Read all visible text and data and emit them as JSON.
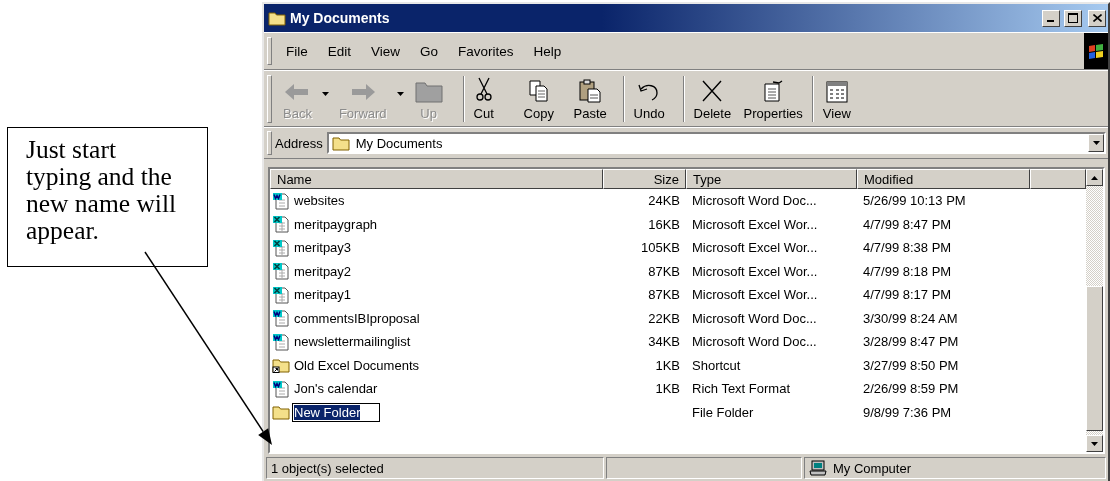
{
  "callout": {
    "text": "Just start typing and the new name will appear."
  },
  "window": {
    "title": "My Documents"
  },
  "menu": [
    "File",
    "Edit",
    "View",
    "Go",
    "Favorites",
    "Help"
  ],
  "toolbar": {
    "groups": [
      [
        {
          "label": "Back",
          "kind": "back",
          "disabled": true,
          "dropdown": true
        },
        {
          "label": "Forward",
          "kind": "forward",
          "disabled": true,
          "dropdown": true
        },
        {
          "label": "Up",
          "kind": "up",
          "disabled": true,
          "dropdown": false
        }
      ],
      [
        {
          "label": "Cut",
          "kind": "cut",
          "disabled": false,
          "dropdown": false
        },
        {
          "label": "Copy",
          "kind": "copy",
          "disabled": false,
          "dropdown": false
        },
        {
          "label": "Paste",
          "kind": "paste",
          "disabled": false,
          "dropdown": false
        }
      ],
      [
        {
          "label": "Undo",
          "kind": "undo",
          "disabled": false,
          "dropdown": false
        }
      ],
      [
        {
          "label": "Delete",
          "kind": "delete",
          "disabled": false,
          "dropdown": false
        },
        {
          "label": "Properties",
          "kind": "properties",
          "disabled": false,
          "dropdown": false
        }
      ],
      [
        {
          "label": "View",
          "kind": "views",
          "disabled": false,
          "dropdown": false
        }
      ]
    ]
  },
  "address": {
    "label": "Address",
    "value": "My Documents"
  },
  "table": {
    "columns": [
      "Name",
      "Size",
      "Type",
      "Modified"
    ],
    "rows": [
      {
        "kind": "word",
        "name": "websites",
        "size": "24KB",
        "type": "Microsoft Word Doc...",
        "modified": "5/26/99 10:13 PM",
        "selected": false
      },
      {
        "kind": "excel",
        "name": "meritpaygraph",
        "size": "16KB",
        "type": "Microsoft Excel Wor...",
        "modified": "4/7/99 8:47 PM",
        "selected": false
      },
      {
        "kind": "excel",
        "name": "meritpay3",
        "size": "105KB",
        "type": "Microsoft Excel Wor...",
        "modified": "4/7/99 8:38 PM",
        "selected": false
      },
      {
        "kind": "excel",
        "name": "meritpay2",
        "size": "87KB",
        "type": "Microsoft Excel Wor...",
        "modified": "4/7/99 8:18 PM",
        "selected": false
      },
      {
        "kind": "excel",
        "name": "meritpay1",
        "size": "87KB",
        "type": "Microsoft Excel Wor...",
        "modified": "4/7/99 8:17 PM",
        "selected": false
      },
      {
        "kind": "word",
        "name": "commentsIBIproposal",
        "size": "22KB",
        "type": "Microsoft Word Doc...",
        "modified": "3/30/99 8:24 AM",
        "selected": false
      },
      {
        "kind": "word",
        "name": "newslettermailinglist",
        "size": "34KB",
        "type": "Microsoft Word Doc...",
        "modified": "3/28/99 8:47 PM",
        "selected": false
      },
      {
        "kind": "shortcut",
        "name": "Old Excel Documents",
        "size": "1KB",
        "type": "Shortcut",
        "modified": "3/27/99 8:50 PM",
        "selected": false
      },
      {
        "kind": "word",
        "name": "Jon's calendar",
        "size": "1KB",
        "type": "Rich Text Format",
        "modified": "2/26/99 8:59 PM",
        "selected": false
      },
      {
        "kind": "folder",
        "name": "New Folder",
        "type": "File Folder",
        "modified": "9/8/99 7:36 PM",
        "selected": true
      }
    ]
  },
  "status_bar": {
    "selection": "1 object(s) selected",
    "zone": "My Computer"
  }
}
